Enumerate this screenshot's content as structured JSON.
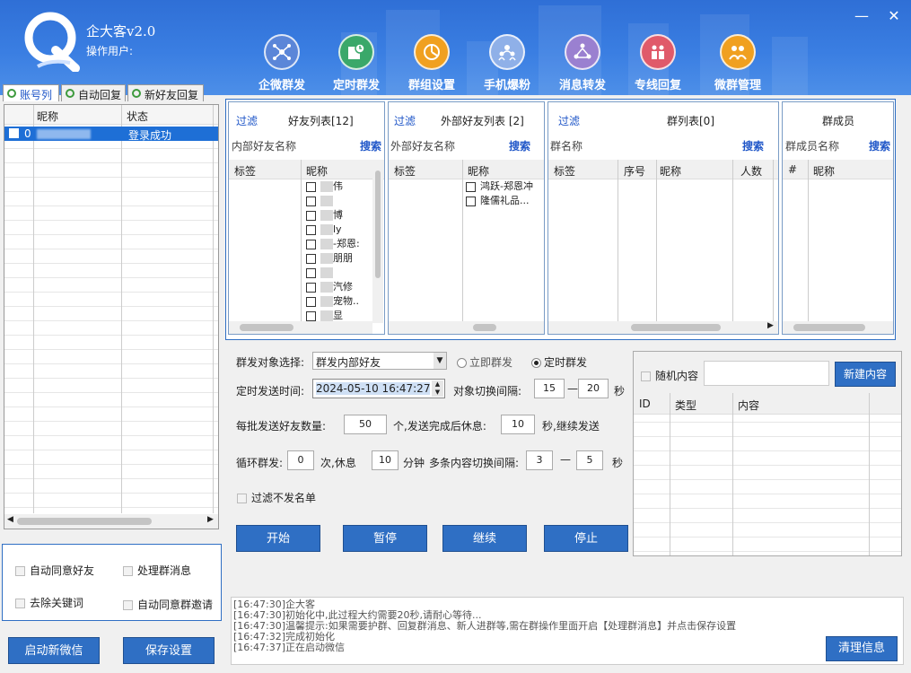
{
  "app": {
    "title": "企大客v2.0",
    "operator_label": "操作用户:"
  },
  "window": {
    "minimize": "—",
    "close": "✕"
  },
  "nav": [
    {
      "label": "企微群发",
      "icon": "network-icon"
    },
    {
      "label": "定时群发",
      "icon": "schedule-icon"
    },
    {
      "label": "群组设置",
      "icon": "pie-chart-icon"
    },
    {
      "label": "手机爆粉",
      "icon": "people-icon"
    },
    {
      "label": "消息转发",
      "icon": "forward-icon"
    },
    {
      "label": "专线回复",
      "icon": "reply-icon"
    },
    {
      "label": "微群管理",
      "icon": "group-manage-icon"
    }
  ],
  "left_tabs": [
    "账号列",
    "自动回复",
    "新好友回复"
  ],
  "accounts": {
    "headers": [
      "昵称",
      "状态"
    ],
    "rows": [
      {
        "index": "0",
        "name": "",
        "status": "登录成功",
        "checked": true
      }
    ]
  },
  "left_options": {
    "auto_accept": "自动同意好友",
    "handle_group": "处理群消息",
    "remove_keywords": "去除关键词",
    "auto_accept_group": "自动同意群邀请"
  },
  "left_buttons": {
    "start_wechat": "启动新微信",
    "save_settings": "保存设置"
  },
  "friends_panel": {
    "filter": "过滤",
    "title": "好友列表[12]",
    "search_label": "内部好友名称",
    "search": "搜索",
    "col_tag": "标签",
    "col_name": "昵称",
    "items": [
      "伟",
      "",
      "博",
      "ly",
      "-郑恩:",
      "朋朋",
      "",
      "汽修",
      "宠物..",
      "显"
    ]
  },
  "external_panel": {
    "filter": "过滤",
    "title": "外部好友列表 [2]",
    "search_label": "外部好友名称",
    "search": "搜索",
    "col_tag": "标签",
    "col_name": "昵称",
    "items": [
      "鸿跃-郑恩冲",
      "隆儒礼品..."
    ]
  },
  "groups_panel": {
    "filter": "过滤",
    "title": "群列表[0]",
    "search_label": "群名称",
    "search": "搜索",
    "col_tag": "标签",
    "col_no": "序号",
    "col_name": "昵称",
    "col_count": "人数"
  },
  "members_panel": {
    "title": "群成员",
    "search_label": "群成员名称",
    "search": "搜索",
    "col_hash": "#",
    "col_name": "昵称"
  },
  "settings": {
    "target_label": "群发对象选择:",
    "target_value": "群发内部好友",
    "send_now": "立即群发",
    "send_scheduled": "定时群发",
    "time_label": "定时发送时间:",
    "time_value": "2024-05-10 16:47:27",
    "switch_label": "对象切换间隔:",
    "switch_from": "15",
    "dash": "—",
    "switch_to": "20",
    "sec": "秒",
    "batch_label": "每批发送好友数量:",
    "batch_value": "50",
    "batch_mid": "个,发送完成后休息:",
    "rest_value": "10",
    "batch_tail": "秒,继续发送",
    "loop_label": "循环群发:",
    "loop_value": "0",
    "loop_mid": "次,休息",
    "loop_rest": "10",
    "loop_min": "分钟",
    "multi_label": "多条内容切换间隔:",
    "multi_from": "3",
    "multi_to": "5",
    "multi_sec": "秒",
    "skip_blacklist": "过滤不发名单"
  },
  "actions": {
    "start": "开始",
    "pause": "暂停",
    "resume": "继续",
    "stop": "停止"
  },
  "content_panel": {
    "random": "随机内容",
    "new_content": "新建内容",
    "col_id": "ID",
    "col_type": "类型",
    "col_content": "内容"
  },
  "log": {
    "lines": [
      "[16:47:30]企大客",
      "[16:47:30]初始化中,此过程大约需要20秒,请耐心等待...",
      "[16:47:30]温馨提示:如果需要护群、回复群消息、新人进群等,需在群操作里面开启【处理群消息】并点击保存设置",
      "[16:47:32]完成初始化",
      "[16:47:37]正在启动微信"
    ],
    "clear": "清理信息"
  }
}
